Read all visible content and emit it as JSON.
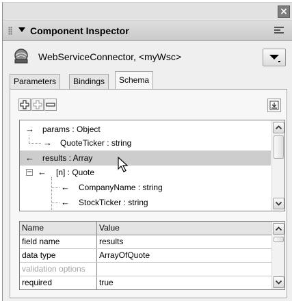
{
  "panel": {
    "title": "Component Inspector",
    "close_glyph": "×",
    "title_icon": "collapse-triangle-icon"
  },
  "component": {
    "name": "WebServiceConnector, <myWsc>",
    "icon": "web-service-icon"
  },
  "tabs": [
    {
      "label": "Parameters",
      "active": false
    },
    {
      "label": "Bindings",
      "active": false
    },
    {
      "label": "Schema",
      "active": true
    }
  ],
  "toolbar": {
    "add_icon": "add-field-icon",
    "add_child_icon": "add-child-field-icon",
    "remove_icon": "remove-field-icon",
    "import_icon": "import-schema-icon"
  },
  "tree": {
    "items": [
      {
        "label": "params : Object",
        "direction": "in"
      },
      {
        "label": "QuoteTicker : string",
        "direction": "in"
      },
      {
        "label": "results : Array",
        "direction": "out",
        "selected": true
      },
      {
        "label": "[n] : Quote",
        "direction": "out",
        "expander": "−"
      },
      {
        "label": "CompanyName : string",
        "direction": "out"
      },
      {
        "label": "StockTicker : string",
        "direction": "out"
      }
    ]
  },
  "grid": {
    "headers": [
      "Name",
      "Value"
    ],
    "rows": [
      {
        "name": "field name",
        "value": "results"
      },
      {
        "name": "data type",
        "value": "ArrayOfQuote"
      },
      {
        "name": "validation options",
        "value": "",
        "disabled": true
      },
      {
        "name": "required",
        "value": "true"
      }
    ]
  },
  "colors": {
    "selection": "#cdcdcd",
    "panel_bg": "#efefef"
  }
}
